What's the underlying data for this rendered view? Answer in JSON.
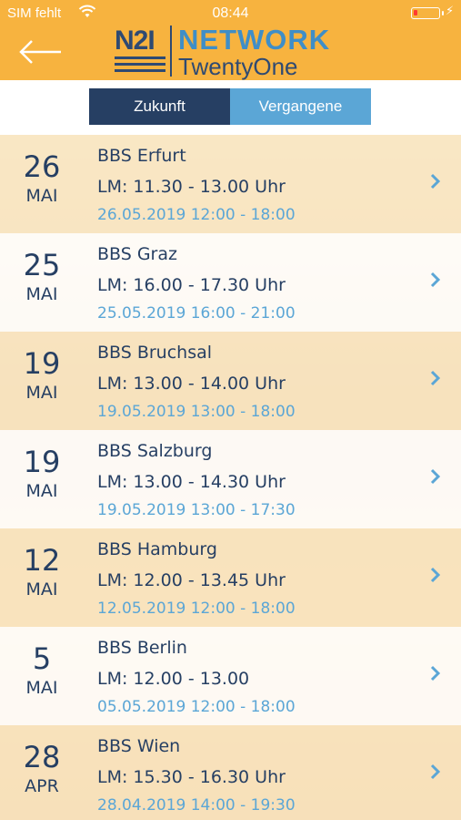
{
  "status_bar": {
    "carrier": "SIM fehlt",
    "time": "08:44",
    "wifi_icon": "wifi-icon",
    "battery_icon": "battery-icon"
  },
  "header": {
    "back_icon": "arrow-left-icon",
    "logo": {
      "mark": "N2I",
      "line1": "NETWORK",
      "line2": "TwentyOne"
    },
    "colors": {
      "background": "#f7b33f",
      "navy": "#2f4a72",
      "blue": "#3f8ec7"
    }
  },
  "tabs": [
    {
      "label": "Zukunft",
      "selected": true
    },
    {
      "label": "Vergangene",
      "selected": false
    }
  ],
  "events": [
    {
      "day": "26",
      "month": "MAI",
      "title": "BBS Erfurt",
      "lm": "LM: 11.30 - 13.00 Uhr",
      "datetime": "26.05.2019 12:00 - 18:00"
    },
    {
      "day": "25",
      "month": "MAI",
      "title": "BBS Graz",
      "lm": "LM: 16.00 - 17.30 Uhr",
      "datetime": "25.05.2019 16:00 - 21:00"
    },
    {
      "day": "19",
      "month": "MAI",
      "title": "BBS Bruchsal",
      "lm": "LM: 13.00 - 14.00 Uhr",
      "datetime": "19.05.2019 13:00 - 18:00"
    },
    {
      "day": "19",
      "month": "MAI",
      "title": "BBS Salzburg",
      "lm": "LM: 13.00 - 14.30 Uhr",
      "datetime": "19.05.2019 13:00 - 17:30"
    },
    {
      "day": "12",
      "month": "MAI",
      "title": "BBS Hamburg",
      "lm": "LM: 12.00 - 13.45 Uhr",
      "datetime": "12.05.2019 12:00 - 18:00"
    },
    {
      "day": "5",
      "month": "MAI",
      "title": "BBS Berlin",
      "lm": "LM: 12.00 - 13.00",
      "datetime": "05.05.2019 12:00 - 18:00"
    },
    {
      "day": "28",
      "month": "APR",
      "title": "BBS Wien",
      "lm": "LM: 15.30 - 16.30 Uhr",
      "datetime": "28.04.2019 14:00 - 19:30"
    }
  ],
  "colors": {
    "accent": "#5ba6d6",
    "navy": "#263f63",
    "tab_active": "#263f63",
    "tab_inactive": "#5ba6d6"
  }
}
